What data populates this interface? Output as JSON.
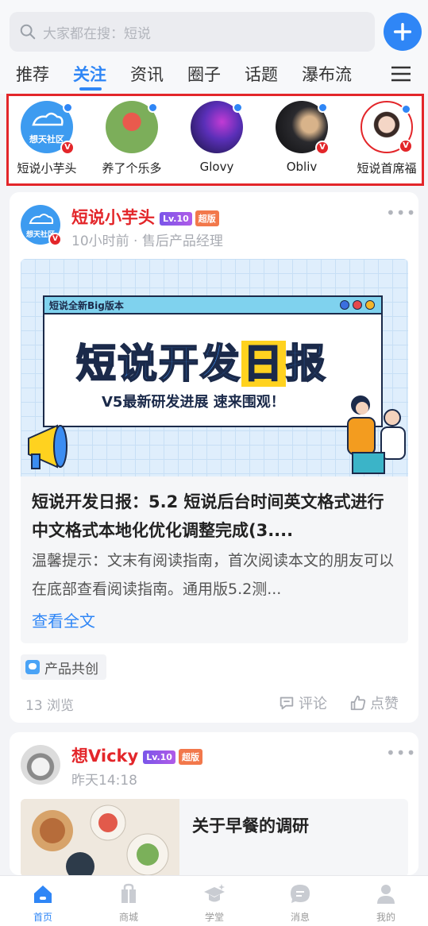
{
  "search": {
    "placeholder": "大家都在搜：短说"
  },
  "tabs": [
    {
      "label": "推荐"
    },
    {
      "label": "关注"
    },
    {
      "label": "资讯"
    },
    {
      "label": "圈子"
    },
    {
      "label": "话题"
    },
    {
      "label": "瀑布流"
    }
  ],
  "following": [
    {
      "name": "短说小芋头"
    },
    {
      "name": "养了个乐多"
    },
    {
      "name": "Glovy"
    },
    {
      "name": "Obliv"
    },
    {
      "name": "短说首席福"
    }
  ],
  "post1": {
    "author": "短说小芋头",
    "level": "Lv.10",
    "badge": "超版",
    "avatar_text": "想天社区",
    "meta": "10小时前 · 售后产品经理",
    "banner_bar": "短说全新Big版本",
    "banner_title_a": "短说开发",
    "banner_title_b": "日",
    "banner_title_c": "报",
    "banner_subtitle": "V5最新研发进展 速来围观！",
    "title": "短说开发日报：5.2 短说后台时间英文格式进行中文格式本地化优化调整完成(3....",
    "excerpt": "温馨提示：文末有阅读指南，首次阅读本文的朋友可以在底部查看阅读指南。通用版5.2测...",
    "read_more": "查看全文",
    "tag": "产品共创",
    "views": "13 浏览",
    "comment": "评论",
    "like": "点赞"
  },
  "post2": {
    "author": "想Vicky",
    "level": "Lv.10",
    "badge": "超版",
    "meta": "昨天14:18",
    "title": "关于早餐的调研"
  },
  "nav": [
    {
      "label": "首页"
    },
    {
      "label": "商城"
    },
    {
      "label": "学堂"
    },
    {
      "label": "消息"
    },
    {
      "label": "我的"
    }
  ],
  "colors": {
    "accent": "#2f86f6",
    "author_red": "#e3262a"
  }
}
